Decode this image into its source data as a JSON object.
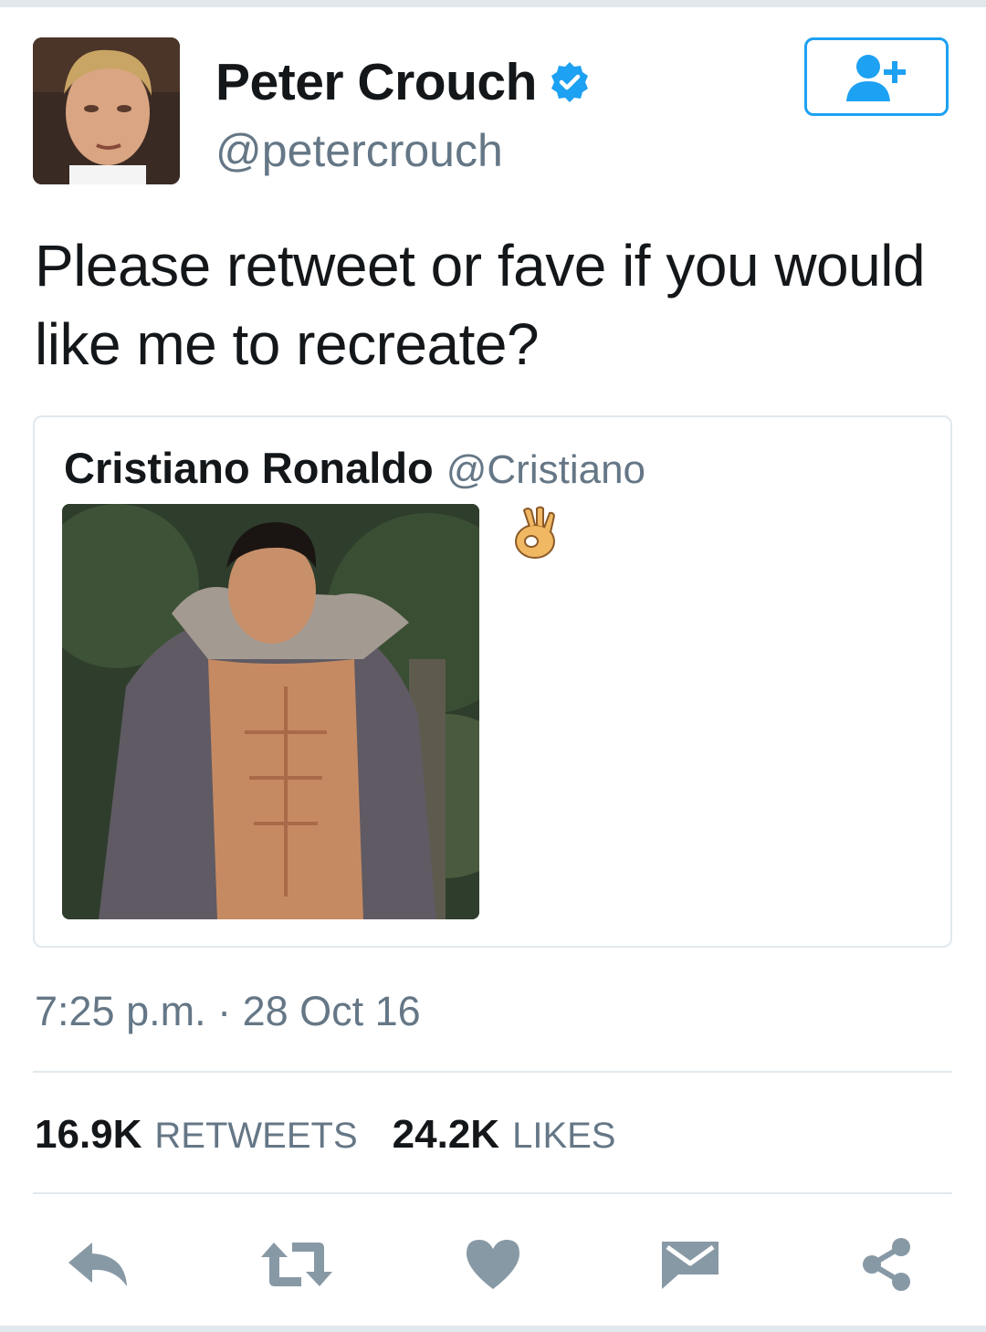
{
  "author": {
    "name": "Peter Crouch",
    "handle": "@petercrouch",
    "verified_icon": "verified-badge-icon",
    "follow_icon": "follow-user-plus-icon"
  },
  "tweet": {
    "text": "Please retweet or fave if you would like me to recreate?",
    "timestamp": "7:25 p.m. · 28 Oct 16"
  },
  "quoted_tweet": {
    "name": "Cristiano Ronaldo",
    "handle": "@Cristiano",
    "emoji_icon": "ok-hand-emoji-icon"
  },
  "stats": {
    "retweets_count": "16.9K",
    "retweets_label": "RETWEETS",
    "likes_count": "24.2K",
    "likes_label": "LIKES"
  },
  "actions": [
    "reply-icon",
    "retweet-icon",
    "like-heart-icon",
    "direct-message-icon",
    "share-icon"
  ],
  "colors": {
    "accent": "#1da1f2",
    "icon_gray": "#8899a6",
    "secondary_text": "#657786",
    "divider": "#e1e8ed"
  }
}
